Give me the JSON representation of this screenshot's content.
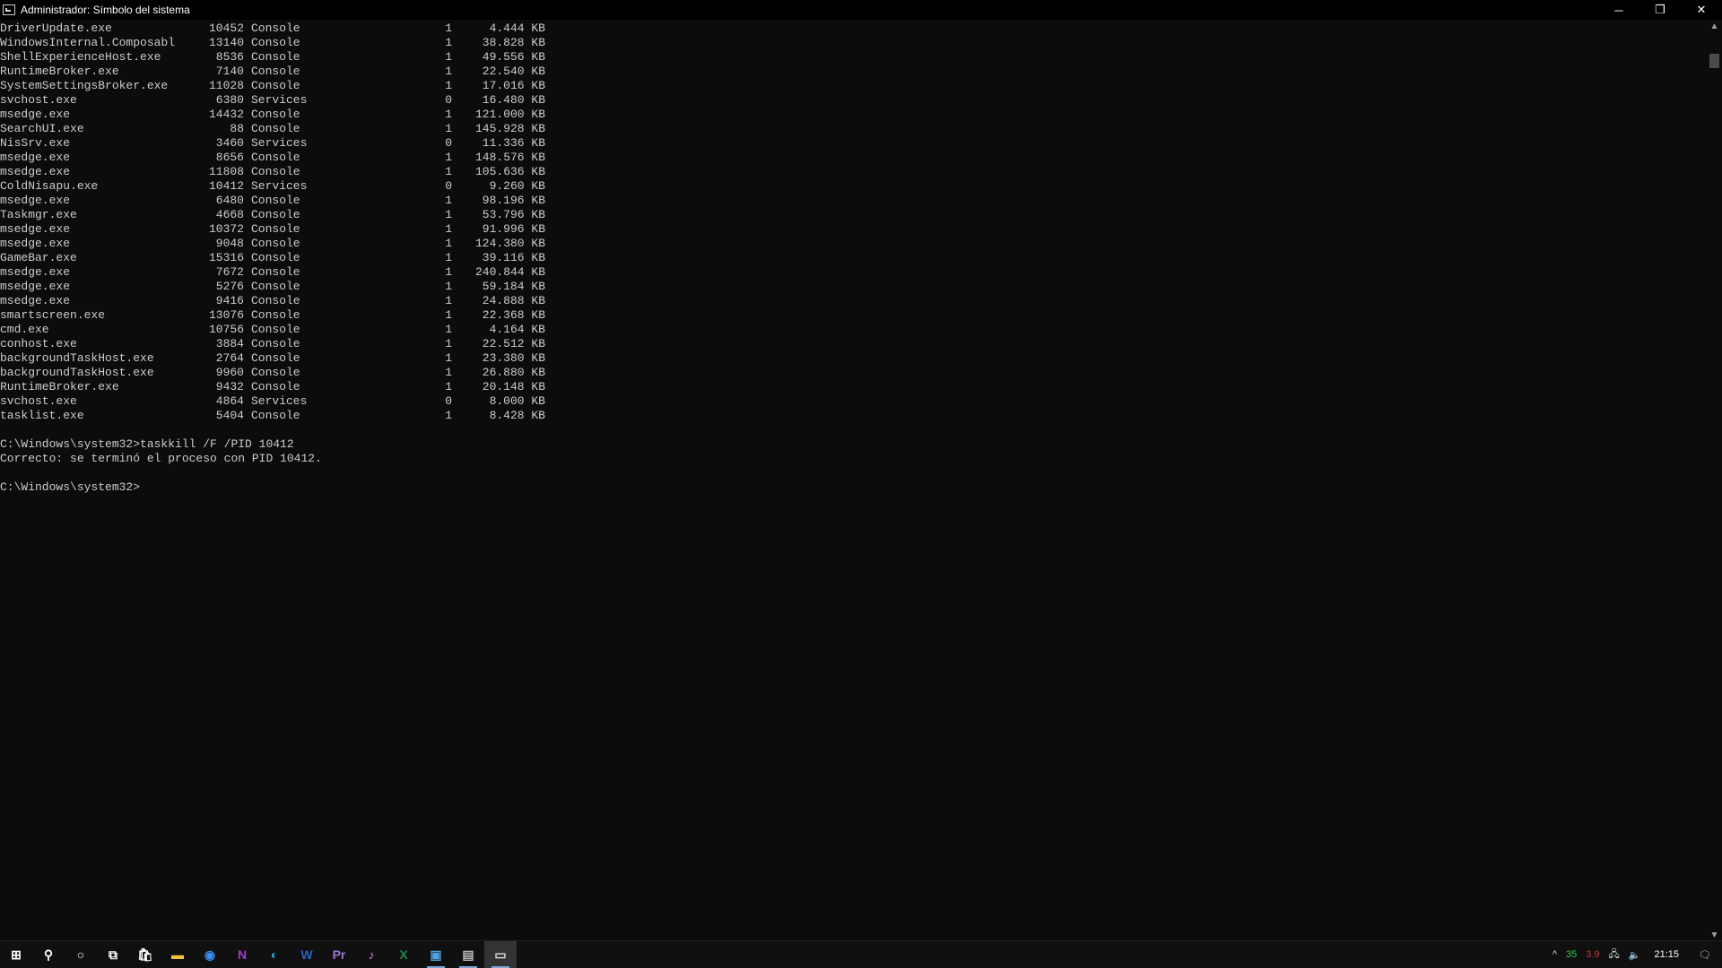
{
  "window": {
    "title": "Administrador: Símbolo del sistema"
  },
  "window_controls": {
    "minimize": "─",
    "restore": "❐",
    "close": "✕"
  },
  "processes": [
    {
      "name": "DriverUpdate.exe",
      "pid": "10452",
      "session": "Console",
      "num": "1",
      "mem": "4.444 KB"
    },
    {
      "name": "WindowsInternal.Composabl",
      "pid": "13140",
      "session": "Console",
      "num": "1",
      "mem": "38.828 KB"
    },
    {
      "name": "ShellExperienceHost.exe",
      "pid": "8536",
      "session": "Console",
      "num": "1",
      "mem": "49.556 KB"
    },
    {
      "name": "RuntimeBroker.exe",
      "pid": "7140",
      "session": "Console",
      "num": "1",
      "mem": "22.540 KB"
    },
    {
      "name": "SystemSettingsBroker.exe",
      "pid": "11028",
      "session": "Console",
      "num": "1",
      "mem": "17.016 KB"
    },
    {
      "name": "svchost.exe",
      "pid": "6380",
      "session": "Services",
      "num": "0",
      "mem": "16.480 KB"
    },
    {
      "name": "msedge.exe",
      "pid": "14432",
      "session": "Console",
      "num": "1",
      "mem": "121.000 KB"
    },
    {
      "name": "SearchUI.exe",
      "pid": "88",
      "session": "Console",
      "num": "1",
      "mem": "145.928 KB"
    },
    {
      "name": "NisSrv.exe",
      "pid": "3460",
      "session": "Services",
      "num": "0",
      "mem": "11.336 KB"
    },
    {
      "name": "msedge.exe",
      "pid": "8656",
      "session": "Console",
      "num": "1",
      "mem": "148.576 KB"
    },
    {
      "name": "msedge.exe",
      "pid": "11808",
      "session": "Console",
      "num": "1",
      "mem": "105.636 KB"
    },
    {
      "name": "ColdNisapu.exe",
      "pid": "10412",
      "session": "Services",
      "num": "0",
      "mem": "9.260 KB"
    },
    {
      "name": "msedge.exe",
      "pid": "6480",
      "session": "Console",
      "num": "1",
      "mem": "98.196 KB"
    },
    {
      "name": "Taskmgr.exe",
      "pid": "4668",
      "session": "Console",
      "num": "1",
      "mem": "53.796 KB"
    },
    {
      "name": "msedge.exe",
      "pid": "10372",
      "session": "Console",
      "num": "1",
      "mem": "91.996 KB"
    },
    {
      "name": "msedge.exe",
      "pid": "9048",
      "session": "Console",
      "num": "1",
      "mem": "124.380 KB"
    },
    {
      "name": "GameBar.exe",
      "pid": "15316",
      "session": "Console",
      "num": "1",
      "mem": "39.116 KB"
    },
    {
      "name": "msedge.exe",
      "pid": "7672",
      "session": "Console",
      "num": "1",
      "mem": "240.844 KB"
    },
    {
      "name": "msedge.exe",
      "pid": "5276",
      "session": "Console",
      "num": "1",
      "mem": "59.184 KB"
    },
    {
      "name": "msedge.exe",
      "pid": "9416",
      "session": "Console",
      "num": "1",
      "mem": "24.888 KB"
    },
    {
      "name": "smartscreen.exe",
      "pid": "13076",
      "session": "Console",
      "num": "1",
      "mem": "22.368 KB"
    },
    {
      "name": "cmd.exe",
      "pid": "10756",
      "session": "Console",
      "num": "1",
      "mem": "4.164 KB"
    },
    {
      "name": "conhost.exe",
      "pid": "3884",
      "session": "Console",
      "num": "1",
      "mem": "22.512 KB"
    },
    {
      "name": "backgroundTaskHost.exe",
      "pid": "2764",
      "session": "Console",
      "num": "1",
      "mem": "23.380 KB"
    },
    {
      "name": "backgroundTaskHost.exe",
      "pid": "9960",
      "session": "Console",
      "num": "1",
      "mem": "26.880 KB"
    },
    {
      "name": "RuntimeBroker.exe",
      "pid": "9432",
      "session": "Console",
      "num": "1",
      "mem": "20.148 KB"
    },
    {
      "name": "svchost.exe",
      "pid": "4864",
      "session": "Services",
      "num": "0",
      "mem": "8.000 KB"
    },
    {
      "name": "tasklist.exe",
      "pid": "5404",
      "session": "Console",
      "num": "1",
      "mem": "8.428 KB"
    }
  ],
  "commands": {
    "kill_command": "C:\\Windows\\system32>taskkill /F /PID 10412",
    "kill_result": "Correcto: se terminó el proceso con PID 10412.",
    "prompt": "C:\\Windows\\system32>"
  },
  "taskbar": {
    "icons": [
      {
        "name": "start-icon",
        "glyph": "⊞",
        "color": "#ffffff"
      },
      {
        "name": "search-icon",
        "glyph": "⚲",
        "color": "#ffffff"
      },
      {
        "name": "cortana-icon",
        "glyph": "○",
        "color": "#ffffff"
      },
      {
        "name": "task-view-icon",
        "glyph": "⧉",
        "color": "#ffffff"
      },
      {
        "name": "store-icon",
        "glyph": "🛍",
        "color": "#ffffff"
      },
      {
        "name": "file-explorer-icon",
        "glyph": "▬",
        "color": "#f0c040"
      },
      {
        "name": "chrome-icon",
        "glyph": "◉",
        "color": "#3b8cf0"
      },
      {
        "name": "onenote-icon",
        "glyph": "N",
        "color": "#9a3fc6"
      },
      {
        "name": "edge-icon",
        "glyph": "◐",
        "color": "#2aa3d9"
      },
      {
        "name": "word-icon",
        "glyph": "W",
        "color": "#2b62c0"
      },
      {
        "name": "premiere-icon",
        "glyph": "Pr",
        "color": "#9b74d6"
      },
      {
        "name": "itunes-icon",
        "glyph": "♪",
        "color": "#e06fc4"
      },
      {
        "name": "excel-icon",
        "glyph": "X",
        "color": "#1f8a4c"
      },
      {
        "name": "control-panel-icon",
        "glyph": "▣",
        "color": "#4ea3e2"
      },
      {
        "name": "network-app-icon",
        "glyph": "▤",
        "color": "#bbbbbb"
      },
      {
        "name": "command-prompt-icon",
        "glyph": "▭",
        "color": "#dddddd"
      }
    ]
  },
  "tray": {
    "chevron": "^",
    "temp_green": "35",
    "temp_red": "3.9",
    "network": "🖧",
    "volume": "🔈",
    "time": "21:15",
    "notifications": "🗨"
  },
  "colors": {
    "console_bg": "#0c0c0c",
    "console_text": "#cccccc",
    "taskbar_bg": "#101010"
  }
}
